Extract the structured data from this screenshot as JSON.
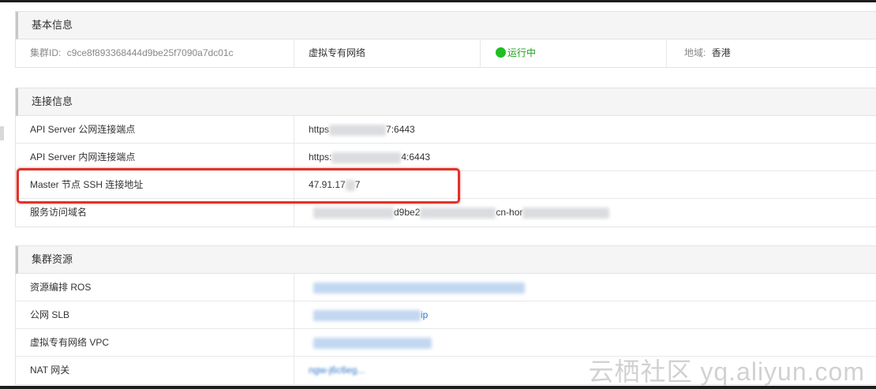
{
  "basic": {
    "title": "基本信息",
    "cluster_id_label": "集群ID:",
    "cluster_id": "c9ce8f893368444d9be25f7090a7dc01c",
    "network_type": "虚拟专有网络",
    "status": "运行中",
    "region_label": "地域:",
    "region": "香港"
  },
  "connection": {
    "title": "连接信息",
    "rows": [
      {
        "label": "API Server 公网连接端点",
        "value_prefix": "https",
        "value_suffix": "7:6443"
      },
      {
        "label": "API Server 内网连接端点",
        "value_prefix": "https:",
        "value_suffix": "4:6443"
      },
      {
        "label": "Master 节点 SSH 连接地址",
        "value_prefix": "47.91.17",
        "value_suffix": "7"
      },
      {
        "label": "服务访问域名",
        "value_prefix": "",
        "value_mid": "d9be2",
        "value_suffix": "cn-hor"
      }
    ]
  },
  "resources": {
    "title": "集群资源",
    "rows": [
      {
        "label": "资源编排 ROS",
        "value_suffix": ""
      },
      {
        "label": "公网 SLB",
        "value_suffix": "ip"
      },
      {
        "label": "虚拟专有网络 VPC",
        "value_suffix": ""
      },
      {
        "label": "NAT 网关",
        "value_suffix": "ngw-j6c6eg..."
      }
    ]
  },
  "watermark": "云栖社区 yq.aliyun.com",
  "colors": {
    "status_green": "#1fbf21",
    "link_blue": "#2f74c9",
    "highlight_red": "#e0332a"
  }
}
